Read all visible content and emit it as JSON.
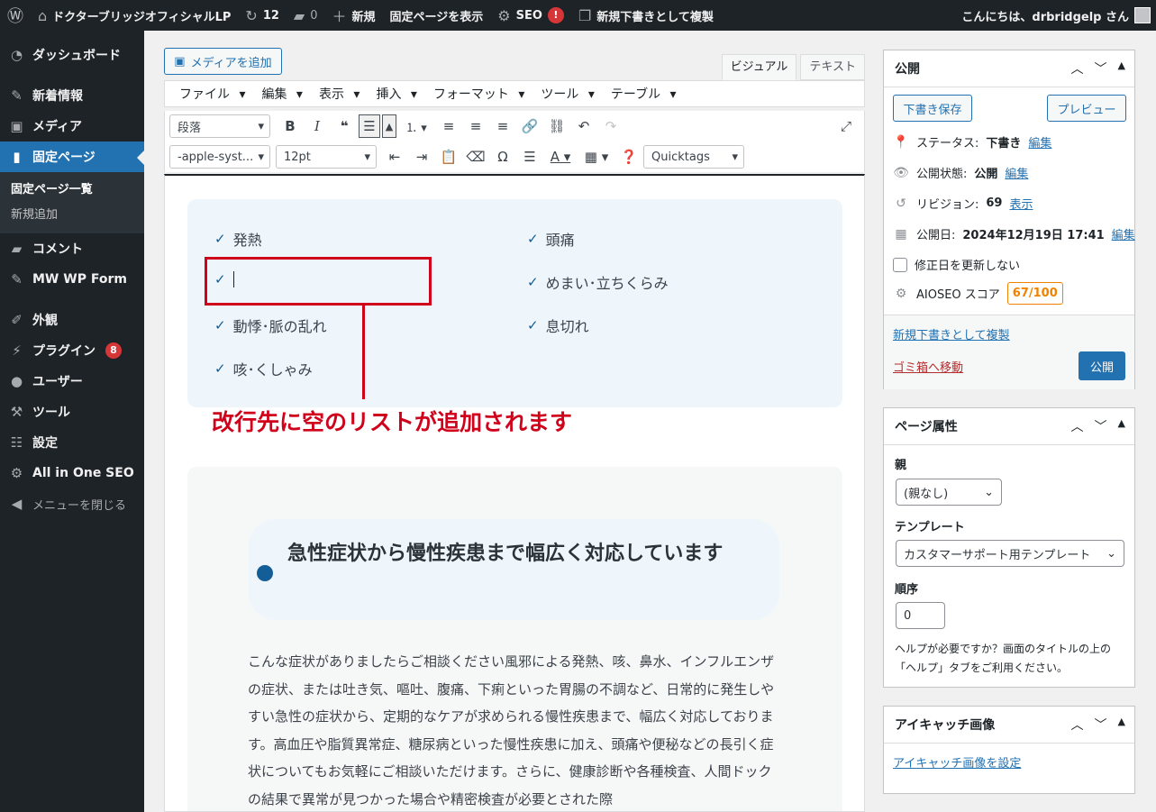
{
  "adminbar": {
    "site_name": "ドクターブリッジオフィシャルLP",
    "updates": "12",
    "comments": "0",
    "new": "新規",
    "view_page": "固定ページを表示",
    "seo": "SEO",
    "seo_badge": "!",
    "duplicate": "新規下書きとして複製",
    "greeting": "こんにちは、drbridgelp さん"
  },
  "sidebar": {
    "items": [
      {
        "label": "ダッシュボード",
        "icon": "dashboard-icon"
      },
      {
        "label": "新着情報",
        "icon": "pin-icon"
      },
      {
        "label": "メディア",
        "icon": "media-icon"
      },
      {
        "label": "固定ページ",
        "icon": "page-icon"
      },
      {
        "label": "コメント",
        "icon": "comment-icon"
      },
      {
        "label": "MW WP Form",
        "icon": "pin-icon"
      },
      {
        "label": "外観",
        "icon": "brush-icon"
      },
      {
        "label": "プラグイン",
        "icon": "plugin-icon",
        "badge": "8"
      },
      {
        "label": "ユーザー",
        "icon": "user-icon"
      },
      {
        "label": "ツール",
        "icon": "wrench-icon"
      },
      {
        "label": "設定",
        "icon": "settings-icon"
      },
      {
        "label": "All in One SEO",
        "icon": "aioseo-icon"
      }
    ],
    "sub": [
      "固定ページ一覧",
      "新規追加"
    ],
    "collapse": "メニューを閉じる"
  },
  "editor": {
    "add_media": "メディアを追加",
    "tab_visual": "ビジュアル",
    "tab_text": "テキスト",
    "menus": [
      "ファイル",
      "編集",
      "表示",
      "挿入",
      "フォーマット",
      "ツール",
      "テーブル"
    ],
    "format_select": "段落",
    "font_select": "-apple-syst...",
    "size_select": "12pt",
    "quicktags": "Quicktags"
  },
  "content": {
    "list": [
      "発熱",
      "頭痛",
      "",
      "めまい･立ちくらみ",
      "動悸･脈の乱れ",
      "息切れ",
      "咳･くしゃみ"
    ],
    "annotation": "改行先に空のリストが追加されます",
    "heading": "急性症状から慢性疾患まで幅広く対応しています",
    "paragraph": "こんな症状がありましたらご相談ください風邪による発熱、咳、鼻水、インフルエンザの症状、または吐き気、嘔吐、腹痛、下痢といった胃腸の不調など、日常的に発生しやすい急性の症状から、定期的なケアが求められる慢性疾患まで、幅広く対応しております。高血圧や脂質異常症、糖尿病といった慢性疾患に加え、頭痛や便秘などの長引く症状についてもお気軽にご相談いただけます。さらに、健康診断や各種検査、人間ドックの結果で異常が見つかった場合や精密検査が必要とされた際"
  },
  "publish": {
    "title": "公開",
    "save_draft": "下書き保存",
    "preview": "プレビュー",
    "status_label": "ステータス:",
    "status_value": "下書き",
    "visibility_label": "公開状態:",
    "visibility_value": "公開",
    "revision_label": "リビジョン:",
    "revision_value": "69",
    "date_label": "公開日:",
    "date_value": "2024年12月19日 17:41",
    "edit": "編集",
    "show": "表示",
    "no_update": "修正日を更新しない",
    "aioseo_label": "AIOSEO スコア",
    "aioseo_score": "67/100",
    "duplicate": "新規下書きとして複製",
    "trash": "ゴミ箱へ移動",
    "publish_btn": "公開"
  },
  "attributes": {
    "title": "ページ属性",
    "parent_label": "親",
    "parent_value": "(親なし)",
    "template_label": "テンプレート",
    "template_value": "カスタマーサポート用テンプレート",
    "order_label": "順序",
    "order_value": "0",
    "help": "ヘルプが必要ですか？画面のタイトルの上の「ヘルプ」タブをご利用ください。"
  },
  "thumbnail": {
    "title": "アイキャッチ画像",
    "set_link": "アイキャッチ画像を設定"
  }
}
